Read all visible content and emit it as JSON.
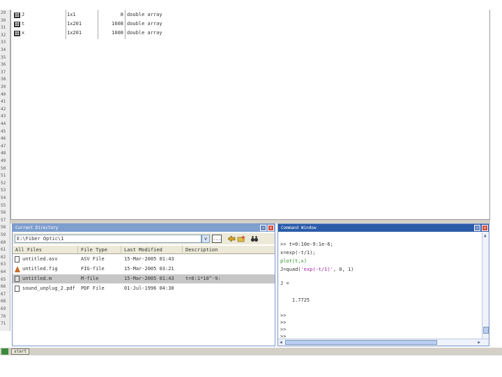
{
  "gutter": {
    "lines": [
      "29",
      "30",
      "31",
      "32",
      "33",
      "34",
      "35",
      "36",
      "37",
      "38",
      "39",
      "40",
      "41",
      "42",
      "43",
      "44",
      "45",
      "46",
      "47",
      "48",
      "49",
      "50",
      "51",
      "52",
      "53",
      "54",
      "55",
      "56",
      "57",
      "58",
      "59",
      "60",
      "61",
      "62",
      "63",
      "64",
      "65",
      "66",
      "67",
      "68",
      "69",
      "70",
      "71"
    ]
  },
  "variables": [
    {
      "name": "J",
      "size": "1x1",
      "bytes": "8",
      "class": "double array"
    },
    {
      "name": "t",
      "size": "1x201",
      "bytes": "1608",
      "class": "double array"
    },
    {
      "name": "x",
      "size": "1x201",
      "bytes": "1608",
      "class": "double array"
    }
  ],
  "current_directory": {
    "title": "Current Directory",
    "path": "E:\\Fiber Optic\\1",
    "dropdown_glyph": "v",
    "browse_label": "...",
    "columns": [
      "All Files",
      "File Type",
      "Last Modified",
      "Description"
    ],
    "files": [
      {
        "name": "untitled.asv",
        "type": "ASV File",
        "modified": "15-Mar-2005 01:43",
        "description": "",
        "icon": "doc"
      },
      {
        "name": "untitled.fig",
        "type": "FIG-file",
        "modified": "15-Mar-2005 03:21",
        "description": "",
        "icon": "fig"
      },
      {
        "name": "untitled.m",
        "type": "M-file",
        "modified": "15-Mar-2005 01:43",
        "description": "t=0:1*10^-9:",
        "icon": "m"
      },
      {
        "name": "sound_unplug_2.pdf",
        "type": "PDF File",
        "modified": "01-Jul-1996 04:30",
        "description": "",
        "icon": "doc"
      }
    ]
  },
  "command_window": {
    "title": "Command Window",
    "lines": [
      {
        "text": ">> t=0:10e-9:1e-6;",
        "style": "normal"
      },
      {
        "text": "x=exp(-t/1);",
        "style": "normal"
      },
      {
        "text": "plot(t,x)",
        "style": "green"
      },
      {
        "text_pre": "J=quad(",
        "text_str": "'exp(-t/1)'",
        "text_post": ", 0, 1)",
        "style": "mixed"
      },
      {
        "text": "J =",
        "style": "normal"
      },
      {
        "text": "    1.7725",
        "style": "normal"
      },
      {
        "text": ">>",
        "style": "normal"
      },
      {
        "text": ">>",
        "style": "normal"
      },
      {
        "text": ">>",
        "style": "normal"
      },
      {
        "text": ">>",
        "style": "normal"
      }
    ]
  },
  "window_buttons": {
    "undock": "↗",
    "close": "x"
  },
  "taskbar": {
    "start_label": "start"
  }
}
